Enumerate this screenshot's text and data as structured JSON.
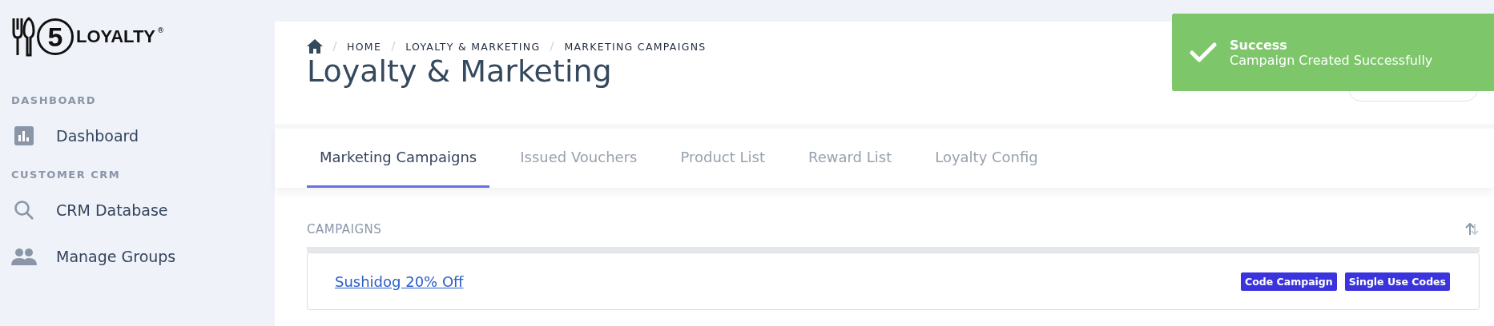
{
  "logo": {
    "number": "5",
    "word": "LOYALTY",
    "mark": "®"
  },
  "sidebar": {
    "sections": [
      {
        "heading": "DASHBOARD",
        "items": [
          {
            "label": "Dashboard",
            "kind": "chart"
          }
        ]
      },
      {
        "heading": "CUSTOMER CRM",
        "items": [
          {
            "label": "CRM Database",
            "kind": "search"
          },
          {
            "label": "Manage Groups",
            "kind": "people"
          }
        ]
      }
    ]
  },
  "breadcrumb": [
    "HOME",
    "LOYALTY & MARKETING",
    "MARKETING CAMPAIGNS"
  ],
  "page_title": "Loyalty & Marketing",
  "tabs": [
    {
      "label": "Marketing Campaigns",
      "selected": true
    },
    {
      "label": "Issued Vouchers",
      "selected": false
    },
    {
      "label": "Product List",
      "selected": false
    },
    {
      "label": "Reward List",
      "selected": false
    },
    {
      "label": "Loyalty Config",
      "selected": false
    }
  ],
  "campaigns": {
    "heading": "CAMPAIGNS",
    "rows": [
      {
        "name": "Sushidog 20% Off",
        "tags": [
          "Code Campaign",
          "Single Use Codes"
        ]
      }
    ]
  },
  "toast": {
    "title": "Success",
    "message": "Campaign Created Successfully"
  }
}
